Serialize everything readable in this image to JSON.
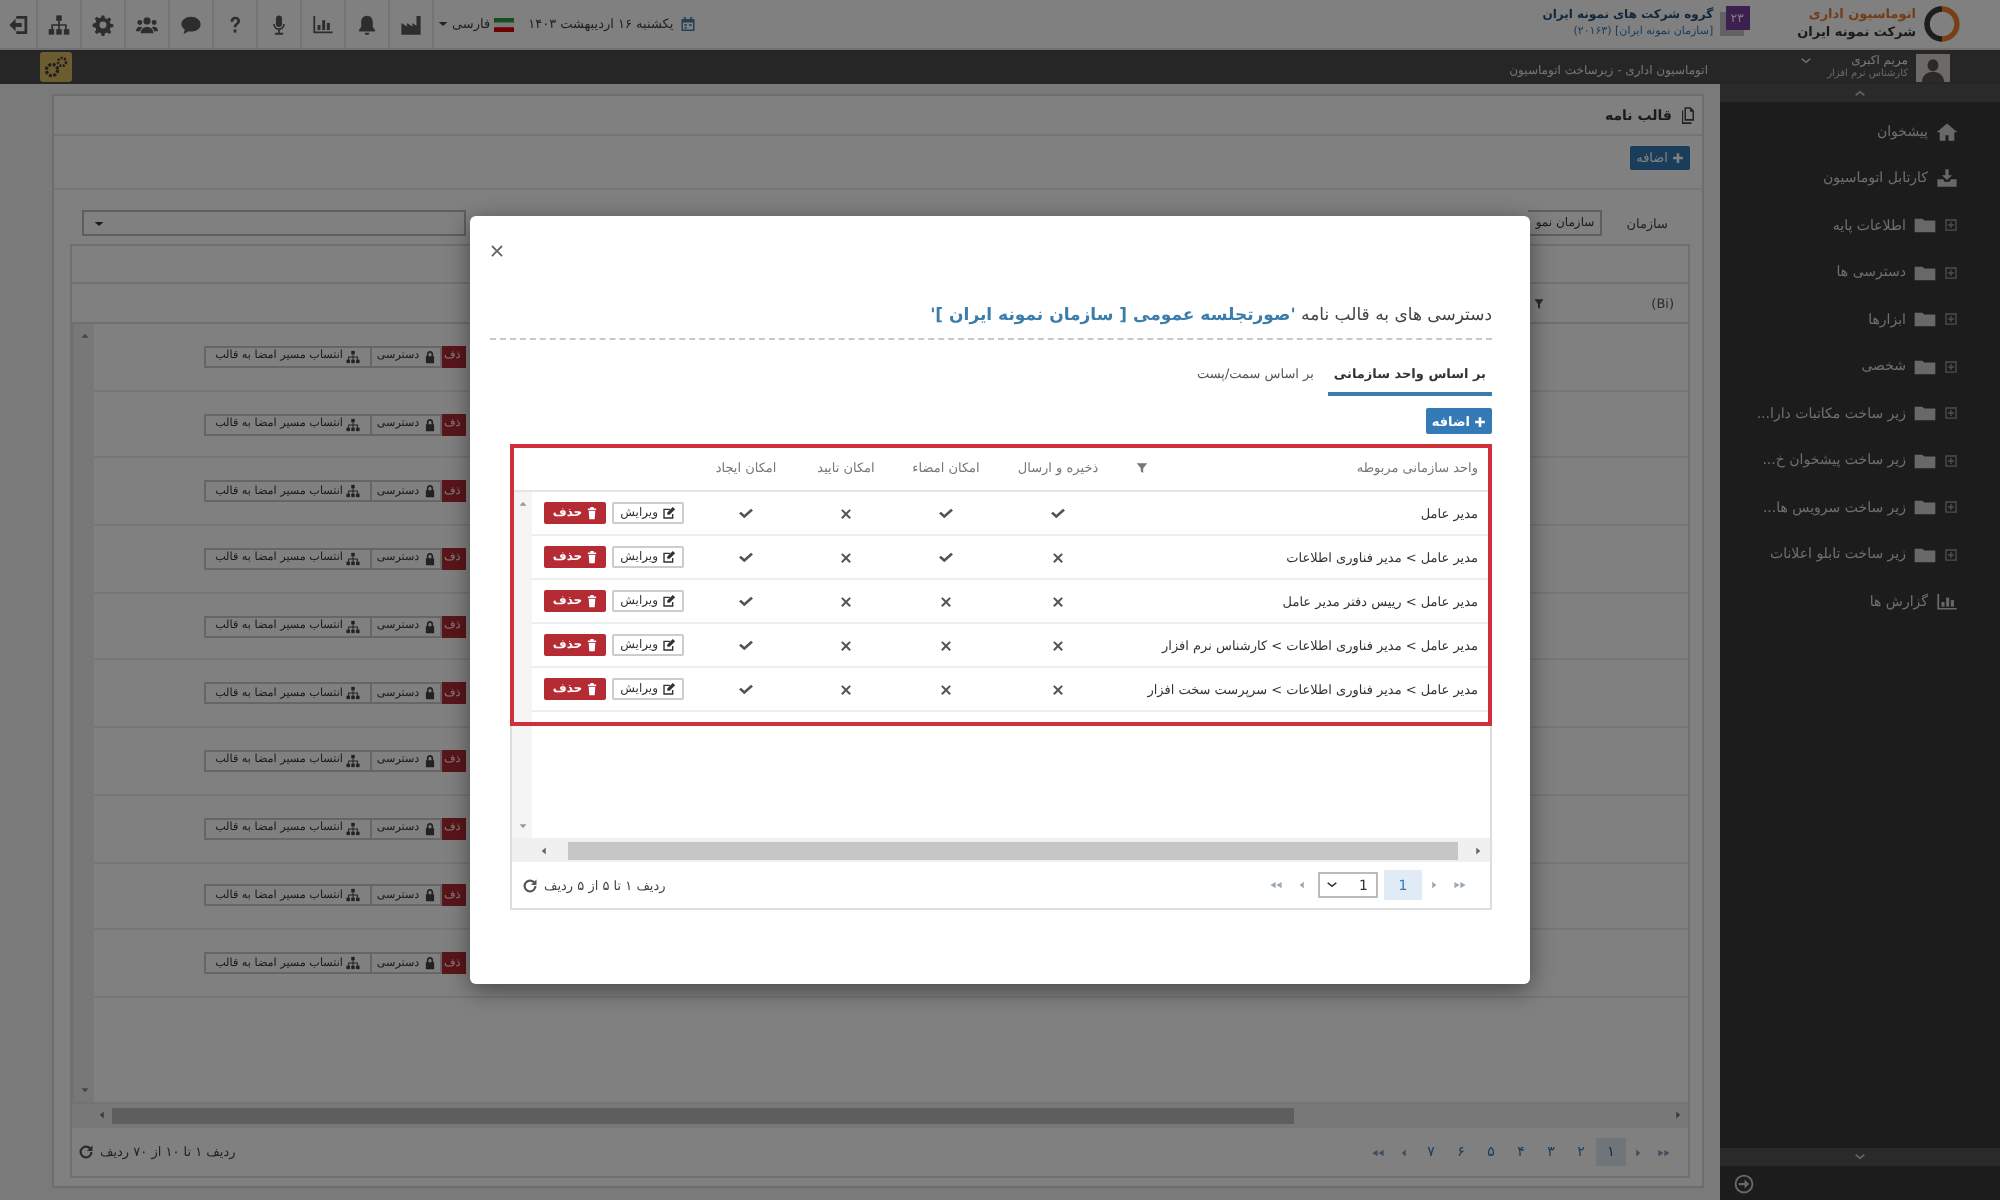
{
  "top_bar": {
    "brand": {
      "title": "اتوماسیون اداری",
      "subtitle": "شرکت نمونه ایران"
    },
    "group": {
      "badge": "۲۳",
      "name": "گروه شرکت های نمونه ایران",
      "organization": "[سازمان نمونه ایران] (۲۰۱۶۳)"
    },
    "language": "فارسی",
    "date": "یکشنبه ۱۶ اردیبهشت ۱۴۰۳"
  },
  "sub_bar": {
    "breadcrumb": "اتوماسیون اداری - زیرساخت اتوماسیون"
  },
  "sidebar": {
    "user": {
      "name": "مریم اکبری",
      "role": "کارشناس نرم افزار"
    },
    "items": [
      {
        "label": "پیشخوان",
        "kind": "home"
      },
      {
        "label": "کارتابل اتوماسیون",
        "kind": "inbox"
      },
      {
        "label": "اطلاعات پایه",
        "kind": "folder"
      },
      {
        "label": "دسترسی ها",
        "kind": "folder"
      },
      {
        "label": "ابزارها",
        "kind": "folder"
      },
      {
        "label": "شخصی",
        "kind": "folder"
      },
      {
        "label": "زیر ساخت مکاتبات دارا...",
        "kind": "folder"
      },
      {
        "label": "زیر ساخت پیشخوان خ...",
        "kind": "folder"
      },
      {
        "label": "زیر ساخت سرویس ها...",
        "kind": "folder"
      },
      {
        "label": "زیر ساخت تابلو اعلانات",
        "kind": "folder"
      },
      {
        "label": "گزارش ها",
        "kind": "report"
      }
    ]
  },
  "page": {
    "title": "قالب نامه",
    "add_button": "اضافه",
    "filter": {
      "label": "سازمان",
      "value": "سازمان نمو"
    },
    "table": {
      "header": "(Bi)",
      "rows": [
        {
          "signature_route": "انتساب مسیر امضا به قالب",
          "access": "دسترسی",
          "delete": "ذف"
        },
        {
          "signature_route": "انتساب مسیر امضا به قالب",
          "access": "دسترسی",
          "delete": "ذف"
        },
        {
          "signature_route": "انتساب مسیر امضا به قالب",
          "access": "دسترسی",
          "delete": "ذف"
        },
        {
          "signature_route": "انتساب مسیر امضا به قالب",
          "access": "دسترسی",
          "delete": "ذف"
        },
        {
          "signature_route": "انتساب مسیر امضا به قالب",
          "access": "دسترسی",
          "delete": "ذف"
        },
        {
          "signature_route": "انتساب مسیر امضا به قالب",
          "access": "دسترسی",
          "delete": "ذف"
        },
        {
          "signature_route": "انتساب مسیر امضا به قالب",
          "access": "دسترسی",
          "delete": "ذف"
        },
        {
          "signature_route": "انتساب مسیر امضا به قالب",
          "access": "دسترسی",
          "delete": "ذف"
        },
        {
          "signature_route": "انتساب مسیر امضا به قالب",
          "access": "دسترسی",
          "delete": "ذف"
        },
        {
          "signature_route": "انتساب مسیر امضا به قالب",
          "access": "دسترسی",
          "delete": "ذف"
        }
      ]
    },
    "pager": {
      "pages": [
        {
          "label": "۱",
          "selected": true
        },
        {
          "label": "۲",
          "selected": false
        },
        {
          "label": "۳",
          "selected": false
        },
        {
          "label": "۴",
          "selected": false
        },
        {
          "label": "۵",
          "selected": false
        },
        {
          "label": "۶",
          "selected": false
        },
        {
          "label": "۷",
          "selected": false
        }
      ],
      "info": "ردیف ۱ تا ۱۰ از ۷۰ ردیف"
    }
  },
  "modal": {
    "title": "دسترسی های به قالب نامه **'صورتجلسه عمومی [ سازمان نمونه ایران ]'**",
    "tabs": [
      {
        "label": "بر اساس واحد سازمانی",
        "selected": true
      },
      {
        "label": "بر اساس سمت/پست",
        "selected": false
      }
    ],
    "add_button": "اضافه",
    "grid": {
      "columns": [
        "واحد سازمانی مربوطه",
        "ذخیره و ارسال",
        "امکان امضاء",
        "امکان تایید",
        "امکان ایجاد"
      ],
      "rows": [
        {
          "unit": "مدیر عامل",
          "permissions": [
            true,
            true,
            false,
            true
          ],
          "edit": "ویرایش",
          "delete": "حذف"
        },
        {
          "unit": "مدیر عامل > مدیر فناوری اطلاعات",
          "permissions": [
            false,
            true,
            false,
            true
          ],
          "edit": "ویرایش",
          "delete": "حذف"
        },
        {
          "unit": "مدیر عامل > رییس دفتر مدیر عامل",
          "permissions": [
            false,
            false,
            false,
            true
          ],
          "edit": "ویرایش",
          "delete": "حذف"
        },
        {
          "unit": "مدیر عامل > مدیر فناوری اطلاعات > کارشناس نرم افزار",
          "permissions": [
            false,
            false,
            false,
            true
          ],
          "edit": "ویرایش",
          "delete": "حذف"
        },
        {
          "unit": "مدیر عامل > مدیر فناوری اطلاعات > سرپرست سخت افزار",
          "permissions": [
            false,
            false,
            false,
            true
          ],
          "edit": "ویرایش",
          "delete": "حذف"
        }
      ],
      "pager": {
        "pages": [
          {
            "label": "1",
            "selected": true
          }
        ],
        "page_select": "1",
        "info": "ردیف ۱ تا ۵ از ۵ ردیف"
      }
    }
  }
}
